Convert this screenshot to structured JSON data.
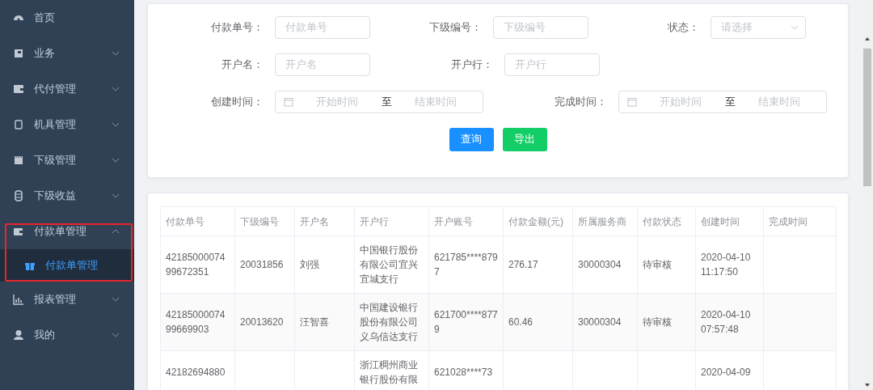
{
  "sidebar": {
    "items": [
      {
        "label": "首页",
        "kind": "link"
      },
      {
        "label": "业务",
        "kind": "submenu",
        "expanded": false
      },
      {
        "label": "代付管理",
        "kind": "submenu",
        "expanded": false
      },
      {
        "label": "机具管理",
        "kind": "submenu",
        "expanded": false
      },
      {
        "label": "下级管理",
        "kind": "submenu",
        "expanded": false
      },
      {
        "label": "下级收益",
        "kind": "submenu",
        "expanded": false
      },
      {
        "label": "付款单管理",
        "kind": "submenu",
        "expanded": true,
        "highlighted": true,
        "children": [
          {
            "label": "付款单管理",
            "selected": true
          }
        ]
      },
      {
        "label": "报表管理",
        "kind": "submenu",
        "expanded": false
      },
      {
        "label": "我的",
        "kind": "submenu",
        "expanded": false
      }
    ]
  },
  "filters": {
    "rows": [
      {
        "fields": [
          {
            "label": "付款单号：",
            "kind": "text",
            "placeholder": "付款单号"
          },
          {
            "label": "下级编号：",
            "kind": "text",
            "placeholder": "下级编号"
          },
          {
            "label": "状态：",
            "kind": "select",
            "placeholder": "请选择"
          }
        ]
      },
      {
        "fields": [
          {
            "label": "开户名：",
            "kind": "text",
            "placeholder": "开户名"
          },
          {
            "label": "开户行：",
            "kind": "text",
            "placeholder": "开户行"
          }
        ]
      },
      {
        "fields": [
          {
            "label": "创建时间：",
            "kind": "daterange",
            "start_placeholder": "开始时间",
            "separator": "至",
            "end_placeholder": "结束时间"
          },
          {
            "label": "完成时间：",
            "kind": "daterange",
            "start_placeholder": "开始时间",
            "separator": "至",
            "end_placeholder": "结束时间"
          }
        ]
      }
    ],
    "buttons": [
      {
        "label": "查询",
        "kind": "primary"
      },
      {
        "label": "导出",
        "kind": "success"
      }
    ]
  },
  "table": {
    "columns": [
      "付款单号",
      "下级编号",
      "开户名",
      "开户行",
      "开户账号",
      "付款金额(元)",
      "所属服务商",
      "付款状态",
      "创建时间",
      "完成时间"
    ],
    "rows": [
      {
        "cells": [
          "4218500007499672351",
          "20031856",
          "刘强",
          "中国银行股份有限公司宜兴宜城支行",
          "621785****8797",
          "276.17",
          "30000304",
          "待审核",
          "2020-04-10 11:17:50",
          ""
        ]
      },
      {
        "cells": [
          "4218500007499669903",
          "20013620",
          "汪智喜",
          "中国建设银行股份有限公司义乌信达支行",
          "621700****8779",
          "60.46",
          "30000304",
          "待审核",
          "2020-04-10 07:57:48",
          ""
        ]
      },
      {
        "cells": [
          "42182694880",
          "",
          "",
          "浙江稠州商业银行股份有限",
          "621028****73",
          "",
          "",
          "",
          "2020-04-09",
          ""
        ]
      }
    ]
  }
}
